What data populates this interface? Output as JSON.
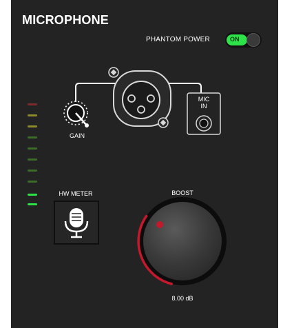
{
  "title": "MICROPHONE",
  "phantom_power": {
    "label": "PHANTOM POWER",
    "state_text": "ON",
    "enabled": true
  },
  "gain": {
    "label": "GAIN"
  },
  "mic_in": {
    "line1": "MIC",
    "line2": "IN"
  },
  "hw_meter": {
    "label": "HW METER",
    "icon": "microphone-icon"
  },
  "boost": {
    "label": "BOOST",
    "value_text": "8.00 dB"
  },
  "meter": {
    "segments": 10,
    "lit": 2
  },
  "colors": {
    "panel": "#232323",
    "accent_green": "#2ee24a",
    "boost_red": "#c4182c",
    "meter_green": "#2ee24a",
    "meter_amber": "#8b8a2c",
    "meter_red": "#7a2c2c"
  }
}
